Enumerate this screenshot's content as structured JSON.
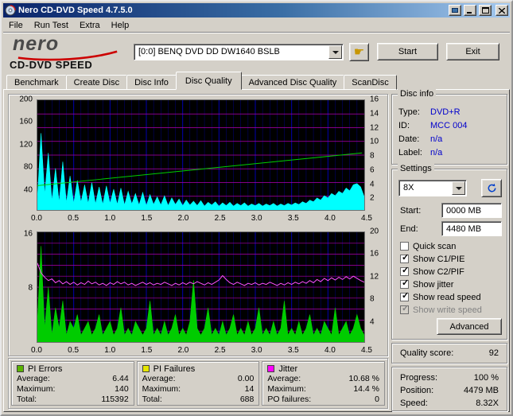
{
  "window": {
    "title": "Nero CD-DVD Speed 4.7.5.0"
  },
  "menu": {
    "items": [
      "File",
      "Run Test",
      "Extra",
      "Help"
    ]
  },
  "header": {
    "logo_line1": "nero",
    "logo_line2": "CD-DVD SPEED",
    "drive_combo": "[0:0]   BENQ DVD DD DW1640 BSLB",
    "start_button": "Start",
    "exit_button": "Exit"
  },
  "tabs": {
    "items": [
      "Benchmark",
      "Create Disc",
      "Disc Info",
      "Disc Quality",
      "Advanced Disc Quality",
      "ScanDisc"
    ],
    "active": "Disc Quality"
  },
  "disc_info": {
    "title": "Disc info",
    "rows": [
      {
        "label": "Type:",
        "value": "DVD+R"
      },
      {
        "label": "ID:",
        "value": "MCC 004"
      },
      {
        "label": "Date:",
        "value": "n/a"
      },
      {
        "label": "Label:",
        "value": "n/a"
      }
    ]
  },
  "settings": {
    "title": "Settings",
    "speed_combo": "8X",
    "start_label": "Start:",
    "start_value": "0000 MB",
    "end_label": "End:",
    "end_value": "4480 MB",
    "checkboxes": [
      {
        "label": "Quick scan",
        "checked": false,
        "disabled": false
      },
      {
        "label": "Show C1/PIE",
        "checked": true,
        "disabled": false
      },
      {
        "label": "Show C2/PIF",
        "checked": true,
        "disabled": false
      },
      {
        "label": "Show jitter",
        "checked": true,
        "disabled": false
      },
      {
        "label": "Show read speed",
        "checked": true,
        "disabled": false
      },
      {
        "label": "Show write speed",
        "checked": true,
        "disabled": true
      }
    ],
    "advanced_button": "Advanced"
  },
  "quality": {
    "label": "Quality score:",
    "value": "92"
  },
  "progress": {
    "rows": [
      {
        "label": "Progress:",
        "value": "100 %"
      },
      {
        "label": "Position:",
        "value": "4479 MB"
      },
      {
        "label": "Speed:",
        "value": "8.32X"
      }
    ]
  },
  "legend": {
    "boxes": [
      {
        "title": "PI Errors",
        "color": "#5ab400",
        "rows": [
          {
            "label": "Average:",
            "value": "6.44"
          },
          {
            "label": "Maximum:",
            "value": "140"
          },
          {
            "label": "Total:",
            "value": "115392"
          }
        ]
      },
      {
        "title": "PI Failures",
        "color": "#e6e600",
        "rows": [
          {
            "label": "Average:",
            "value": "0.00"
          },
          {
            "label": "Maximum:",
            "value": "14"
          },
          {
            "label": "Total:",
            "value": "688"
          }
        ]
      },
      {
        "title": "Jitter",
        "color": "#ff00ff",
        "rows": [
          {
            "label": "Average:",
            "value": "10.68 %"
          },
          {
            "label": "Maximum:",
            "value": "14.4 %"
          },
          {
            "label": "PO failures:",
            "value": "0"
          }
        ]
      }
    ]
  },
  "chart_data": [
    {
      "type": "area",
      "name": "PI Errors / Read speed",
      "x_range": [
        0,
        4.5
      ],
      "x_ticks": [
        "0.0",
        "0.5",
        "1.0",
        "1.5",
        "2.0",
        "2.5",
        "3.0",
        "3.5",
        "4.0",
        "4.5"
      ],
      "left_axis": {
        "label": "PI Errors",
        "range": [
          0,
          200
        ],
        "ticks": [
          200,
          160,
          120,
          80,
          40
        ]
      },
      "right_axis": {
        "label": "Read speed (X)",
        "range": [
          0,
          16
        ],
        "ticks": [
          16,
          14,
          12,
          10,
          8,
          6,
          4,
          2
        ]
      },
      "grid": {
        "bg": "#000000",
        "h_color": "#b000b0",
        "v_color": "#0000b0",
        "h_divisions": 8,
        "v_step": 0.1
      },
      "series": [
        {
          "name": "PI Errors",
          "type": "area",
          "axis": "left",
          "color": "#00ffff",
          "x_start": 0,
          "x_step": 0.05,
          "values": [
            22,
            140,
            28,
            104,
            16,
            76,
            14,
            88,
            13,
            62,
            12,
            54,
            14,
            46,
            12,
            50,
            11,
            42,
            10,
            44,
            12,
            38,
            10,
            40,
            9,
            34,
            11,
            30,
            9,
            32,
            8,
            28,
            10,
            24,
            9,
            26,
            8,
            22,
            10,
            20,
            8,
            18,
            9,
            16,
            8,
            17,
            7,
            14,
            9,
            15,
            7,
            13,
            8,
            14,
            7,
            12,
            8,
            13,
            7,
            11,
            8,
            12,
            7,
            11,
            8,
            12,
            7,
            11,
            8,
            12,
            9,
            13,
            10,
            15,
            12,
            18,
            15,
            22,
            18,
            26,
            22,
            30,
            26,
            34,
            30,
            40,
            35,
            46,
            48,
            42,
            24
          ]
        },
        {
          "name": "Read speed",
          "type": "line",
          "axis": "right",
          "color": "#00d000",
          "points": [
            [
              0,
              3.55
            ],
            [
              4.47,
              8.32
            ]
          ]
        }
      ]
    },
    {
      "type": "area",
      "name": "PI Failures / Jitter",
      "x_range": [
        0,
        4.5
      ],
      "x_ticks": [
        "0.0",
        "0.5",
        "1.0",
        "1.5",
        "2.0",
        "2.5",
        "3.0",
        "3.5",
        "4.0",
        "4.5"
      ],
      "left_axis": {
        "label": "PI Failures",
        "range": [
          0,
          16
        ],
        "ticks": [
          16,
          8
        ]
      },
      "right_axis": {
        "label": "Jitter (%)",
        "range": [
          0,
          20
        ],
        "ticks": [
          20,
          16,
          12,
          8,
          4
        ]
      },
      "grid": {
        "bg": "#000000",
        "h_color": "#b000b0",
        "v_color": "#0000b0",
        "h_divisions": 10,
        "v_step": 0.1
      },
      "series": [
        {
          "name": "PI Failures",
          "type": "area",
          "axis": "left",
          "color": "#00cc00",
          "x_start": 0,
          "x_step": 0.05,
          "values": [
            3,
            14,
            2,
            8,
            1,
            5,
            2,
            6,
            1,
            3,
            2,
            4,
            1,
            2,
            3,
            1,
            2,
            4,
            1,
            2,
            3,
            1,
            2,
            5,
            1,
            2,
            1,
            3,
            2,
            1,
            2,
            6,
            1,
            2,
            1,
            3,
            1,
            2,
            4,
            1,
            2,
            1,
            3,
            9,
            2,
            1,
            2,
            5,
            1,
            2,
            1,
            3,
            1,
            2,
            4,
            1,
            2,
            1,
            3,
            1,
            2,
            5,
            1,
            2,
            1,
            3,
            1,
            2,
            6,
            1,
            2,
            1,
            3,
            1,
            2,
            4,
            1,
            2,
            1,
            3,
            2,
            1,
            5,
            1,
            2,
            3,
            1,
            2,
            4,
            2,
            1
          ]
        },
        {
          "name": "Jitter",
          "type": "line",
          "axis": "right",
          "color": "#ff50ff",
          "x_start": 0,
          "x_step": 0.05,
          "values": [
            14.4,
            12.6,
            11.8,
            11.2,
            11.5,
            10.8,
            11.2,
            10.6,
            11.0,
            10.5,
            10.9,
            10.4,
            10.8,
            10.5,
            11.1,
            10.6,
            10.9,
            10.4,
            10.7,
            10.3,
            10.8,
            10.5,
            11.0,
            10.6,
            10.9,
            10.4,
            10.7,
            10.3,
            10.6,
            10.9,
            10.5,
            10.8,
            10.4,
            10.7,
            10.5,
            10.9,
            10.6,
            10.3,
            10.7,
            10.4,
            10.8,
            10.5,
            10.9,
            10.6,
            11.0,
            10.7,
            10.4,
            10.8,
            10.5,
            10.9,
            11.3,
            12.1,
            11.4,
            10.8,
            10.5,
            10.9,
            10.6,
            10.3,
            10.7,
            10.5,
            10.8,
            10.4,
            10.7,
            10.5,
            10.9,
            10.6,
            10.3,
            10.7,
            10.4,
            10.8,
            10.5,
            10.9,
            10.6,
            11.0,
            10.7,
            11.2,
            10.8,
            11.4,
            11.0,
            11.6,
            11.2,
            11.7,
            11.3,
            11.8,
            11.4,
            11.9,
            11.5,
            12.0,
            11.6,
            11.2,
            10.9
          ]
        }
      ]
    }
  ]
}
